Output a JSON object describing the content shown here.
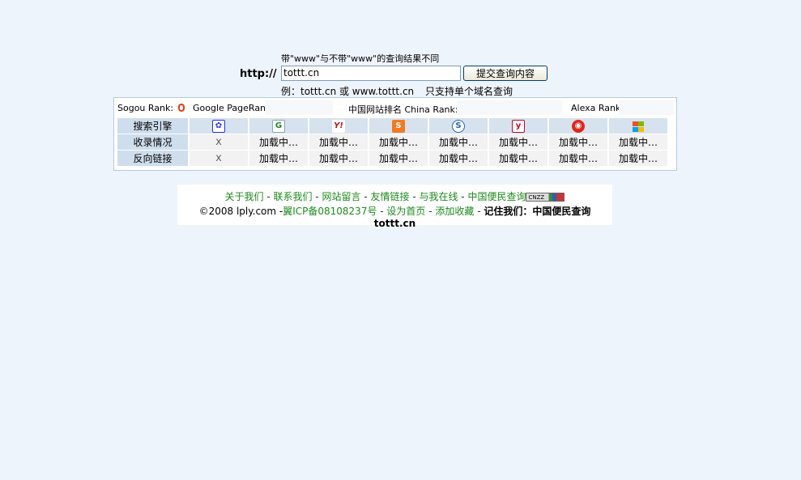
{
  "query": {
    "note_top": "带\"www\"与不带\"www\"的查询结果不同",
    "http_label": "http://",
    "input_value": "tottt.cn",
    "submit_label": "提交查询内容",
    "example": "例：tottt.cn 或 www.tottt.cn",
    "single_domain_note": "只支持单个域名查询"
  },
  "ranks": {
    "sogou_label": "Sogou Rank:",
    "google_label": "Google PageRank:",
    "china_label": "中国网站排名 China Rank:",
    "alexa_label": "Alexa Rank:"
  },
  "engines": {
    "row_labels": [
      "搜索引擎",
      "收录情况",
      "反向链接"
    ],
    "icons": [
      "baidu-icon",
      "google-icon",
      "yahoo-icon",
      "sohu-icon",
      "soso-icon",
      "youdao-icon",
      "sina-icon",
      "msn-icon"
    ],
    "icon_glyphs": [
      "",
      "G",
      "Y!",
      "S",
      "S",
      "y",
      "",
      ""
    ],
    "indexed": [
      "x",
      "加载中…",
      "加载中…",
      "加载中…",
      "加载中…",
      "加载中…",
      "加载中…",
      "加载中…"
    ],
    "backlinks": [
      "x",
      "加载中…",
      "加载中…",
      "加载中…",
      "加载中…",
      "加载中…",
      "加载中…",
      "加载中…"
    ]
  },
  "footer": {
    "links": [
      "关于我们",
      "联系我们",
      "网站留言",
      "友情链接",
      "与我在线",
      "中国便民查询"
    ],
    "cnzz": "CNZZ",
    "copyright": "©2008 lply.com -",
    "icp": "翼ICP备08108237号",
    "set_home": "设为首页",
    "bookmark": "添加收藏",
    "remember": "记住我们：中国便民查询 tottt.cn"
  }
}
